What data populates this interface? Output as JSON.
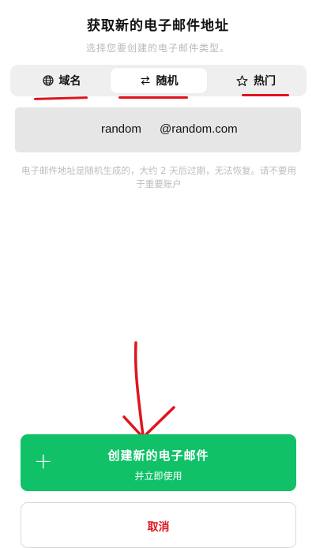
{
  "header": {
    "title": "获取新的电子邮件地址",
    "subtitle": "选择您要创建的电子邮件类型。"
  },
  "tabs": [
    {
      "label": "域名",
      "icon": "globe-icon",
      "active": false
    },
    {
      "label": "随机",
      "icon": "swap-arrows-icon",
      "active": true
    },
    {
      "label": "热门",
      "icon": "star-outline-icon",
      "active": false
    }
  ],
  "email": {
    "username": "random",
    "domain": "@random.com"
  },
  "notice": "电子邮件地址是随机生成的，大约 2 天后过期，无法恢复。请不要用于重要账户",
  "create": {
    "title": "创建新的电子邮件",
    "subtitle": "并立即使用",
    "icon": "plus-icon"
  },
  "cancel": {
    "label": "取消"
  },
  "colors": {
    "accent_green": "#10c168",
    "annotation_red": "#e0141e",
    "cancel_text": "#e0141e"
  }
}
